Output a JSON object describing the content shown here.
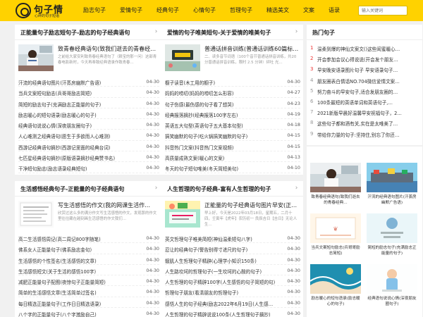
{
  "header": {
    "logo_title": "句子情",
    "logo_sub": "心碎的句子短语"
  },
  "nav": [
    "励志句子",
    "爱情句子",
    "经典句子",
    "心情句子",
    "哲理句子",
    "精选美文",
    "文案",
    "语录"
  ],
  "search": {
    "placeholder": "输入关键词"
  },
  "colors": {
    "header": "#ffd200",
    "hot_rank": "#e33333"
  },
  "sections": [
    {
      "title": "正能量句子励志短句子-励志的句子经典语句",
      "featured": {
        "title": "致青春经典语句(致我们逝去的青春经典…",
        "desc": "之前给大家安利致青春经典语句了（赖宝的那一问）这部青春电影新时，今天再奉致经典语录作致青春…"
      },
      "items": [
        {
          "t": "汗流的经典语句图片(汗蒸房幽默广告语)",
          "d": "04-30"
        },
        {
          "t": "当兵文案短句励志(兵哥哥励志简短)",
          "d": "04-30"
        },
        {
          "t": "简短的励志句子(充满励志正能量的句子)",
          "d": "04-30"
        },
        {
          "t": "励志暖心的短句语录(励志暖心的句子)",
          "d": "04-30"
        },
        {
          "t": "经典语句说说心情(深夜朋友圈句子)",
          "d": "04-30"
        },
        {
          "t": "人心难测之经典语句(愿生于多欲而人心难测)",
          "d": "04-30"
        },
        {
          "t": "西游记经典语句摘抄(西游记里面的经典台词)",
          "d": "04-30"
        },
        {
          "t": "七匹星经典语句摘抄(原版语录摘抄经典赞书名)",
          "d": "04-30"
        },
        {
          "t": "干净短句励志(励志语录经典短句)",
          "d": "04-30"
        }
      ]
    },
    {
      "title": "爱情的句子唯美短句-关于爱情的唯美句子",
      "featured": {
        "title": "普通话拼音训练(普通话训练60篇标…",
        "desc": "二、读多音节词语（100个音节普通话拼音训练，共20分普通话拼音训练，限时 2.5 分钟）砰吐 光…"
      },
      "items": [
        {
          "t": "橱子读音(木工用的橱子)",
          "d": "04-30"
        },
        {
          "t": "妈妈的唠叨(妈妈的唠叨怎么形容)",
          "d": "04-27"
        },
        {
          "t": "句子伤感(最伤感的句子看了想哭)",
          "d": "04-23"
        },
        {
          "t": "经典报落摘抄(经典报落100字左右)",
          "d": "04-19"
        },
        {
          "t": "英语五大句型(英语句子五大基本句型)",
          "d": "04-18"
        },
        {
          "t": "搞笑幽默的句子(吃火锅搞笑幽默的句子)",
          "d": "04-15"
        },
        {
          "t": "抖音热门文案(抖音热门文案视频)",
          "d": "04-15"
        },
        {
          "t": "高质量成熟文案(暖心的文案)",
          "d": "04-13"
        },
        {
          "t": "冬天的句子短句唯美(冬天简短美句)",
          "d": "04-10"
        }
      ]
    },
    {
      "title": "生活感悟经典句子-正能量的句子经典语句",
      "featured": {
        "title": "写生活感悟的作文(我的网课生活作…",
        "desc": "欣赏过这么多的满分作文写生活感悟的作文，发现那的作文里往往藏在越刻画生活感悟的作文我们…"
      },
      "items": [
        {
          "t": "高二生活感悟周记(高二周记800字随笔)",
          "d": "04-30"
        },
        {
          "t": "佛系女人正能量句子(佛系励志金句)",
          "d": "04-30"
        },
        {
          "t": "生活感悟的个性签名(生活感悟的文章)",
          "d": "04-30"
        },
        {
          "t": "生活感悟短文(关于生活的感悟100字)",
          "d": "04-30"
        },
        {
          "t": "减肥正能量句子配图(夜惊句子正能量简短)",
          "d": "04-30"
        },
        {
          "t": "简单的生活感悟文章(生活简单过签名)",
          "d": "04-30"
        },
        {
          "t": "每日精选正能量句子(工作日日精选语录)",
          "d": "04-30"
        },
        {
          "t": "八个字的正能量句子(八个字激励自己)",
          "d": "04-30"
        }
      ]
    },
    {
      "title": "人生哲理的句子经典-富有人生哲理的句子",
      "featured": {
        "title": "正能量的句子经典语句图片早安(正…",
        "desc": "早上好，今天是2022年03月18日，星期五，二月十四，壬寅年【虎年】农历初一 良辰吉日【吉日】无论人生…"
      },
      "items": [
        {
          "t": "英文哲理句子唯美简短(神仙温柔短句八字)",
          "d": "04-30"
        },
        {
          "t": "忍让的经典句子(警告别得寸进尺的句子)",
          "d": "04-30"
        },
        {
          "t": "髋肌人生哲理句子精辟(心理学小知识150条)",
          "d": "04-30"
        },
        {
          "t": "人生路坎坷的哲理句子(一生坎坷的心酸的句子)",
          "d": "04-30"
        },
        {
          "t": "人生哲理的句子精辟100字(人生感悟的句子简短的句)",
          "d": "04-30"
        },
        {
          "t": "哲理句子朋友(看清朋友的哲理句子)",
          "d": "04-30"
        },
        {
          "t": "感悟人生的句子经典(励志2022年6月19日(人生感…",
          "d": "04-30"
        },
        {
          "t": "人生哲理的句子精辟说说100条(人生哲理句子摘抄)",
          "d": "04-30"
        }
      ]
    }
  ],
  "hot": {
    "title": "热门句子",
    "items": [
      "温柔到爆的神仙文案文()这些闺蜜暖心…",
      "开会参加会议心得说说(开会发个朋友…",
      "早安晚安语录图片句子 早安语录句子…",
      "朋友圈表白情话NO.704微信爱情文案…",
      "努力奋斗的早安句子,适合发朋友圈的…",
      "100条最短的英语单词和英语句子,…",
      "2021新版早晨好温馨早安祝福句子，2…",
      "这些句子都和酒有关,实在是太唯美了…",
      "带给你力量的句子:坚持住,别忘了你还…"
    ]
  },
  "gallery": [
    "致青春经典语句(致我们逝去的青春经典…",
    "汗流的经典语句图片(汗蒸房幽默广告语)",
    "当兵文案短句励志(兵哥哥励志简短)",
    "简短的励志句子(充满励志正能量的句子)",
    "励志暖心的短句语录(励志暖心的句子)",
    "经典语句说说心情(深夜朋友圈句子)"
  ]
}
